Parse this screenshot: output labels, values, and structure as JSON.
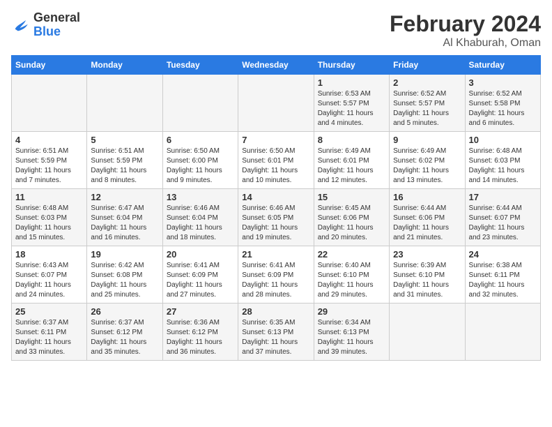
{
  "logo": {
    "text_general": "General",
    "text_blue": "Blue"
  },
  "header": {
    "month": "February 2024",
    "location": "Al Khaburah, Oman"
  },
  "columns": [
    "Sunday",
    "Monday",
    "Tuesday",
    "Wednesday",
    "Thursday",
    "Friday",
    "Saturday"
  ],
  "weeks": [
    [
      {
        "day": "",
        "info": ""
      },
      {
        "day": "",
        "info": ""
      },
      {
        "day": "",
        "info": ""
      },
      {
        "day": "",
        "info": ""
      },
      {
        "day": "1",
        "info": "Sunrise: 6:53 AM\nSunset: 5:57 PM\nDaylight: 11 hours and 4 minutes."
      },
      {
        "day": "2",
        "info": "Sunrise: 6:52 AM\nSunset: 5:57 PM\nDaylight: 11 hours and 5 minutes."
      },
      {
        "day": "3",
        "info": "Sunrise: 6:52 AM\nSunset: 5:58 PM\nDaylight: 11 hours and 6 minutes."
      }
    ],
    [
      {
        "day": "4",
        "info": "Sunrise: 6:51 AM\nSunset: 5:59 PM\nDaylight: 11 hours and 7 minutes."
      },
      {
        "day": "5",
        "info": "Sunrise: 6:51 AM\nSunset: 5:59 PM\nDaylight: 11 hours and 8 minutes."
      },
      {
        "day": "6",
        "info": "Sunrise: 6:50 AM\nSunset: 6:00 PM\nDaylight: 11 hours and 9 minutes."
      },
      {
        "day": "7",
        "info": "Sunrise: 6:50 AM\nSunset: 6:01 PM\nDaylight: 11 hours and 10 minutes."
      },
      {
        "day": "8",
        "info": "Sunrise: 6:49 AM\nSunset: 6:01 PM\nDaylight: 11 hours and 12 minutes."
      },
      {
        "day": "9",
        "info": "Sunrise: 6:49 AM\nSunset: 6:02 PM\nDaylight: 11 hours and 13 minutes."
      },
      {
        "day": "10",
        "info": "Sunrise: 6:48 AM\nSunset: 6:03 PM\nDaylight: 11 hours and 14 minutes."
      }
    ],
    [
      {
        "day": "11",
        "info": "Sunrise: 6:48 AM\nSunset: 6:03 PM\nDaylight: 11 hours and 15 minutes."
      },
      {
        "day": "12",
        "info": "Sunrise: 6:47 AM\nSunset: 6:04 PM\nDaylight: 11 hours and 16 minutes."
      },
      {
        "day": "13",
        "info": "Sunrise: 6:46 AM\nSunset: 6:04 PM\nDaylight: 11 hours and 18 minutes."
      },
      {
        "day": "14",
        "info": "Sunrise: 6:46 AM\nSunset: 6:05 PM\nDaylight: 11 hours and 19 minutes."
      },
      {
        "day": "15",
        "info": "Sunrise: 6:45 AM\nSunset: 6:06 PM\nDaylight: 11 hours and 20 minutes."
      },
      {
        "day": "16",
        "info": "Sunrise: 6:44 AM\nSunset: 6:06 PM\nDaylight: 11 hours and 21 minutes."
      },
      {
        "day": "17",
        "info": "Sunrise: 6:44 AM\nSunset: 6:07 PM\nDaylight: 11 hours and 23 minutes."
      }
    ],
    [
      {
        "day": "18",
        "info": "Sunrise: 6:43 AM\nSunset: 6:07 PM\nDaylight: 11 hours and 24 minutes."
      },
      {
        "day": "19",
        "info": "Sunrise: 6:42 AM\nSunset: 6:08 PM\nDaylight: 11 hours and 25 minutes."
      },
      {
        "day": "20",
        "info": "Sunrise: 6:41 AM\nSunset: 6:09 PM\nDaylight: 11 hours and 27 minutes."
      },
      {
        "day": "21",
        "info": "Sunrise: 6:41 AM\nSunset: 6:09 PM\nDaylight: 11 hours and 28 minutes."
      },
      {
        "day": "22",
        "info": "Sunrise: 6:40 AM\nSunset: 6:10 PM\nDaylight: 11 hours and 29 minutes."
      },
      {
        "day": "23",
        "info": "Sunrise: 6:39 AM\nSunset: 6:10 PM\nDaylight: 11 hours and 31 minutes."
      },
      {
        "day": "24",
        "info": "Sunrise: 6:38 AM\nSunset: 6:11 PM\nDaylight: 11 hours and 32 minutes."
      }
    ],
    [
      {
        "day": "25",
        "info": "Sunrise: 6:37 AM\nSunset: 6:11 PM\nDaylight: 11 hours and 33 minutes."
      },
      {
        "day": "26",
        "info": "Sunrise: 6:37 AM\nSunset: 6:12 PM\nDaylight: 11 hours and 35 minutes."
      },
      {
        "day": "27",
        "info": "Sunrise: 6:36 AM\nSunset: 6:12 PM\nDaylight: 11 hours and 36 minutes."
      },
      {
        "day": "28",
        "info": "Sunrise: 6:35 AM\nSunset: 6:13 PM\nDaylight: 11 hours and 37 minutes."
      },
      {
        "day": "29",
        "info": "Sunrise: 6:34 AM\nSunset: 6:13 PM\nDaylight: 11 hours and 39 minutes."
      },
      {
        "day": "",
        "info": ""
      },
      {
        "day": "",
        "info": ""
      }
    ]
  ]
}
